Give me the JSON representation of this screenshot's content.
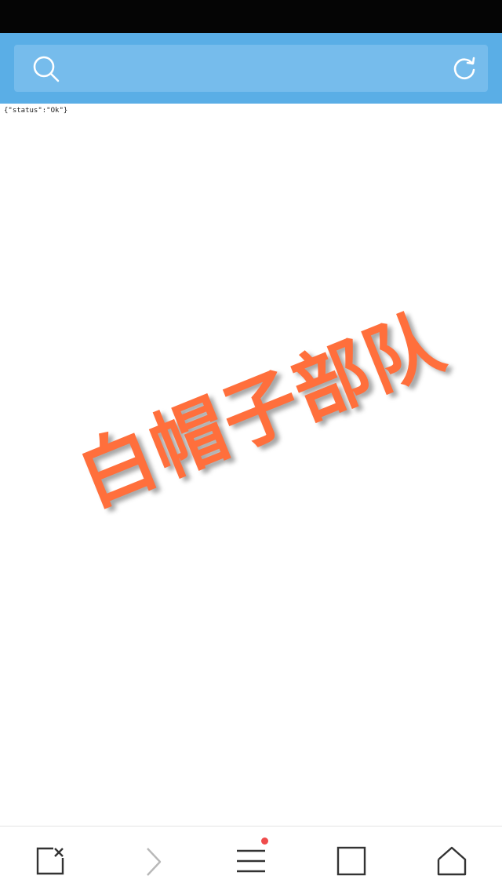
{
  "status_bar": {},
  "header": {
    "url": "",
    "search_icon": "search-icon",
    "refresh_icon": "refresh-icon",
    "accent": "#5aaee6"
  },
  "page": {
    "body_text": "{\"status\":\"Ok\"}"
  },
  "watermark": {
    "text": "白帽子部队",
    "color": "#ff6f3c"
  },
  "bottom_nav": {
    "items": [
      {
        "icon": "close-tab-icon"
      },
      {
        "icon": "forward-icon"
      },
      {
        "icon": "menu-icon",
        "badge": true
      },
      {
        "icon": "tabs-icon"
      },
      {
        "icon": "home-icon"
      }
    ],
    "badge_color": "#ef4b4b"
  }
}
